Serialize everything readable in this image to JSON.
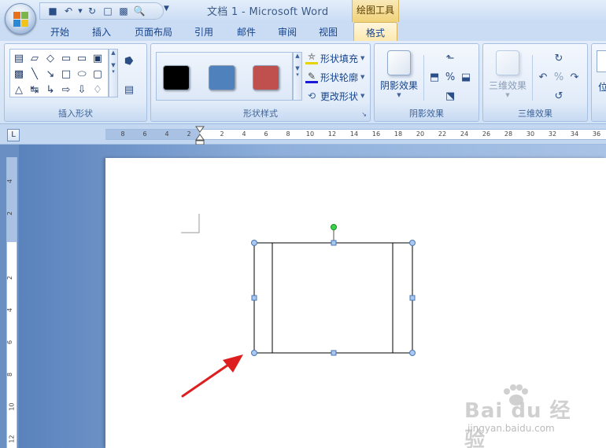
{
  "window": {
    "title": "文档 1 - Microsoft Word",
    "context_tab_group": "绘图工具"
  },
  "quick_access": [
    "save-icon",
    "undo-icon",
    "redo-icon",
    "new-icon",
    "print-icon",
    "print-preview-icon"
  ],
  "tabs": [
    {
      "label": "开始",
      "active": false
    },
    {
      "label": "插入",
      "active": false
    },
    {
      "label": "页面布局",
      "active": false
    },
    {
      "label": "引用",
      "active": false
    },
    {
      "label": "邮件",
      "active": false
    },
    {
      "label": "审阅",
      "active": false
    },
    {
      "label": "视图",
      "active": false
    },
    {
      "label": "格式",
      "active": true
    }
  ],
  "ribbon": {
    "insert_shapes": {
      "label": "插入形状"
    },
    "shape_styles": {
      "label": "形状样式",
      "swatches": [
        "#000000",
        "#4f81bd",
        "#c0504d"
      ],
      "fill_label": "形状填充",
      "outline_label": "形状轮廓",
      "change_label": "更改形状"
    },
    "shadow_effects": {
      "label": "阴影效果",
      "button_label": "阴影效果"
    },
    "threed_effects": {
      "label": "三维效果",
      "button_label": "三维效果"
    },
    "partial_next": "位"
  },
  "rulers": {
    "horizontal_left": [
      "8",
      "6",
      "4",
      "2"
    ],
    "horizontal_right": [
      "2",
      "4",
      "6",
      "8",
      "10",
      "12",
      "14",
      "16",
      "18",
      "20",
      "22",
      "24",
      "26",
      "28",
      "30",
      "32",
      "34",
      "36"
    ],
    "vertical_top": [
      "4",
      "2"
    ],
    "vertical_bottom": [
      "2",
      "4",
      "6",
      "8",
      "10",
      "12"
    ]
  },
  "document": {
    "selected_shape": "process-flowchart-shape",
    "annotation": "red-arrow"
  },
  "watermark": {
    "brand": "Bai du 经验",
    "url": "jingyan.baidu.com"
  }
}
